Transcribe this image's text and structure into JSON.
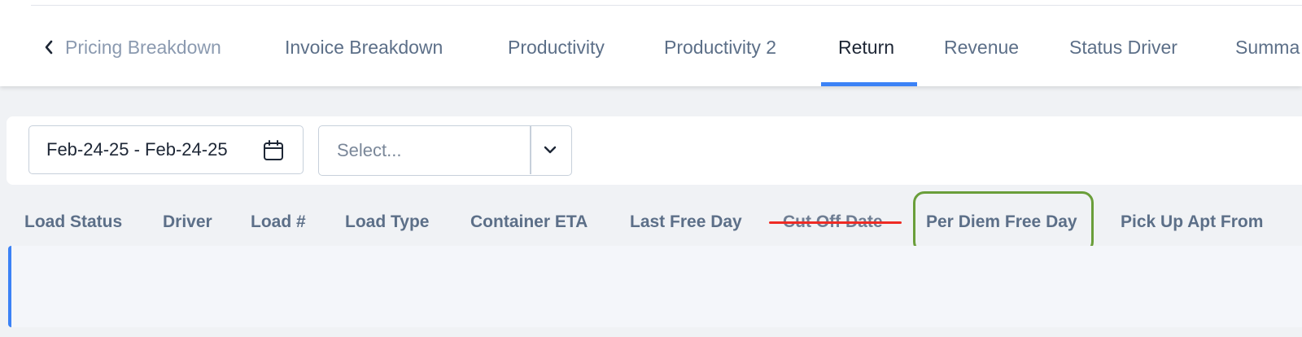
{
  "tabs": [
    {
      "label": "Pricing Breakdown"
    },
    {
      "label": "Invoice Breakdown"
    },
    {
      "label": "Productivity"
    },
    {
      "label": "Productivity 2"
    },
    {
      "label": "Return",
      "active": true
    },
    {
      "label": "Revenue"
    },
    {
      "label": "Status Driver"
    },
    {
      "label": "Summa"
    }
  ],
  "filters": {
    "date_range": "Feb-24-25 - Feb-24-25",
    "select_placeholder": "Select..."
  },
  "columns": [
    {
      "label": "Load Status"
    },
    {
      "label": "Driver"
    },
    {
      "label": "Load #"
    },
    {
      "label": "Load Type"
    },
    {
      "label": "Container ETA"
    },
    {
      "label": "Last Free Day"
    },
    {
      "label": "Cut Off Date",
      "struck_through": true
    },
    {
      "label": "Per Diem Free Day",
      "highlighted": true
    },
    {
      "label": "Pick Up Apt From"
    }
  ],
  "annotations": {
    "strike_color": "#ee2b24",
    "highlight_color": "#6a9e3a"
  },
  "icons": {
    "tab_scroll_left": "chevron-left-icon",
    "date_picker": "calendar-icon",
    "select_dropdown": "chevron-down-icon"
  },
  "colors": {
    "accent": "#3b82f6",
    "tab_text": "#5c6f88",
    "active_tab_text": "#1d2635"
  }
}
